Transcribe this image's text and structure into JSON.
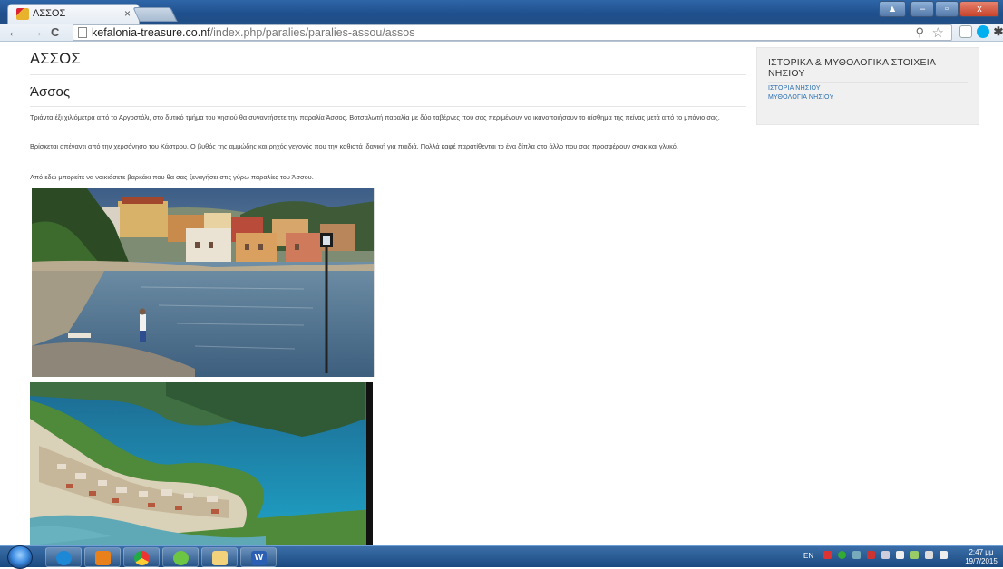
{
  "browser": {
    "tab_title": "ΑΣΣΟΣ",
    "tab_close": "×",
    "url_domain": "kefalonia-treasure.co.nf",
    "url_path": "/index.php/paralies/paralies-assou/assos",
    "back_icon": "←",
    "forward_icon": "→",
    "reload_icon": "C",
    "zoom_icon": "⚲",
    "star_icon": "☆"
  },
  "window": {
    "minimize": "–",
    "maximize": "▫",
    "close": "x",
    "user": "▲"
  },
  "article": {
    "page_title": "ΑΣΣΟΣ",
    "heading": "Άσσος",
    "paragraphs": [
      "Τριάντα έξι χιλιόμετρα από το Αργοστόλι, στο δυτικό τμήμα του νησιού θα συναντήσετε την παραλία Άσσος. Βοτσαλωτή παραλία με δύο ταβέρνες που σας περιμένουν να ικανοποιήσουν το αίσθημα της πείνας μετά από το μπάνιο σας.",
      "Βρίσκεται απέναντι από την χερσόνησο του Κάστρου. Ο βυθός της αμμώδης και ρηχός γεγονός που την καθιστά ιδανική για παιδιά. Πολλά καφέ παρατίθενται το ένα δίπλα στο άλλο που σας προσφέρουν σνακ και γλυκό.",
      "Από εδώ μπορείτε να νοικιάσετε βαρκάκι που θα σας ξεναγήσει στις γύρω παραλίες του Άσσου."
    ]
  },
  "sidebar": {
    "heading": "ΙΣΤΟΡΙΚΑ & ΜΥΘΟΛΟΓΙΚΑ ΣΤΟΙΧΕΙΑ ΝΗΣΙΟΥ",
    "links": [
      "ΙΣΤΟΡΙΑ ΝΗΣΙΟΥ",
      "ΜΥΘΟΛΟΓΙΑ ΝΗΣΙΟΥ"
    ]
  },
  "taskbar": {
    "word_label": "W",
    "language": "EN",
    "time": "2:47 μμ",
    "date": "19/7/2015"
  }
}
